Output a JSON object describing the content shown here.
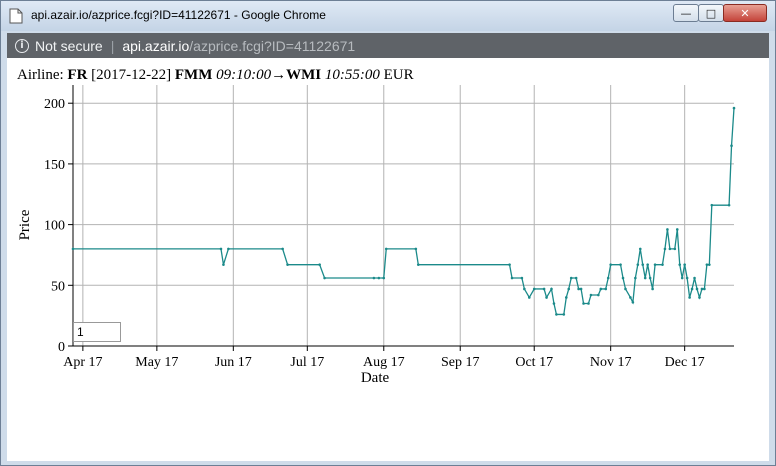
{
  "window": {
    "title": "api.azair.io/azprice.fcgi?ID=41122671 - Google Chrome",
    "min_label": "—",
    "max_label": "□",
    "close_label": "✕"
  },
  "addressbar": {
    "info_icon": "info-icon",
    "security_label": "Not secure",
    "separator": "|",
    "url_host": "api.azair.io",
    "url_path": "/azprice.fcgi?ID=41122671"
  },
  "heading": {
    "airline_prefix": "Airline: ",
    "airline": "FR",
    "date": " [2017-12-22] ",
    "origin": "FMM",
    "dep_time": " 09:10:00",
    "arrow": "→",
    "destination": "WMI",
    "arr_time": " 10:55:00",
    "currency": " EUR"
  },
  "range_input": {
    "value": "1"
  },
  "colors": {
    "line": "#1b8a8a",
    "grid": "#b3b3b3",
    "axis": "#000000"
  },
  "chart_data": {
    "type": "line",
    "title": "",
    "xlabel": "Date",
    "ylabel": "Price",
    "ylim": [
      0,
      215
    ],
    "xlim": [
      "2017-03-28",
      "2017-12-21"
    ],
    "x_ticks": [
      {
        "date": "2017-04-01",
        "label": "Apr 17"
      },
      {
        "date": "2017-05-01",
        "label": "May 17"
      },
      {
        "date": "2017-06-01",
        "label": "Jun 17"
      },
      {
        "date": "2017-07-01",
        "label": "Jul 17"
      },
      {
        "date": "2017-08-01",
        "label": "Aug 17"
      },
      {
        "date": "2017-09-01",
        "label": "Sep 17"
      },
      {
        "date": "2017-10-01",
        "label": "Oct 17"
      },
      {
        "date": "2017-11-01",
        "label": "Nov 17"
      },
      {
        "date": "2017-12-01",
        "label": "Dec 17"
      }
    ],
    "y_ticks": [
      0,
      50,
      100,
      150,
      200
    ],
    "grid": true,
    "series": [
      {
        "points": [
          [
            "2017-03-28",
            80
          ],
          [
            "2017-05-27",
            80
          ],
          [
            "2017-05-28",
            67
          ],
          [
            "2017-05-30",
            80
          ],
          [
            "2017-06-21",
            80
          ],
          [
            "2017-06-23",
            67
          ],
          [
            "2017-07-06",
            67
          ],
          [
            "2017-07-08",
            56
          ],
          [
            "2017-07-28",
            56
          ],
          [
            "2017-07-30",
            56
          ],
          [
            "2017-08-01",
            56
          ],
          [
            "2017-08-02",
            80
          ],
          [
            "2017-08-14",
            80
          ],
          [
            "2017-08-15",
            67
          ],
          [
            "2017-09-21",
            67
          ],
          [
            "2017-09-22",
            56
          ],
          [
            "2017-09-26",
            56
          ],
          [
            "2017-09-27",
            47
          ],
          [
            "2017-09-29",
            40
          ],
          [
            "2017-10-01",
            47
          ],
          [
            "2017-10-05",
            47
          ],
          [
            "2017-10-06",
            40
          ],
          [
            "2017-10-08",
            47
          ],
          [
            "2017-10-09",
            35
          ],
          [
            "2017-10-10",
            26
          ],
          [
            "2017-10-13",
            26
          ],
          [
            "2017-10-14",
            40
          ],
          [
            "2017-10-15",
            47
          ],
          [
            "2017-10-16",
            56
          ],
          [
            "2017-10-18",
            56
          ],
          [
            "2017-10-19",
            47
          ],
          [
            "2017-10-20",
            47
          ],
          [
            "2017-10-21",
            35
          ],
          [
            "2017-10-23",
            35
          ],
          [
            "2017-10-24",
            42
          ],
          [
            "2017-10-27",
            42
          ],
          [
            "2017-10-28",
            47
          ],
          [
            "2017-10-30",
            47
          ],
          [
            "2017-10-31",
            56
          ],
          [
            "2017-11-01",
            67
          ],
          [
            "2017-11-05",
            67
          ],
          [
            "2017-11-06",
            56
          ],
          [
            "2017-11-07",
            47
          ],
          [
            "2017-11-09",
            40
          ],
          [
            "2017-11-10",
            36
          ],
          [
            "2017-11-11",
            56
          ],
          [
            "2017-11-12",
            67
          ],
          [
            "2017-11-13",
            80
          ],
          [
            "2017-11-14",
            67
          ],
          [
            "2017-11-15",
            56
          ],
          [
            "2017-11-16",
            67
          ],
          [
            "2017-11-17",
            56
          ],
          [
            "2017-11-18",
            47
          ],
          [
            "2017-11-19",
            67
          ],
          [
            "2017-11-22",
            67
          ],
          [
            "2017-11-23",
            80
          ],
          [
            "2017-11-24",
            96
          ],
          [
            "2017-11-25",
            80
          ],
          [
            "2017-11-27",
            80
          ],
          [
            "2017-11-28",
            96
          ],
          [
            "2017-11-29",
            67
          ],
          [
            "2017-11-30",
            56
          ],
          [
            "2017-12-01",
            67
          ],
          [
            "2017-12-02",
            56
          ],
          [
            "2017-12-03",
            40
          ],
          [
            "2017-12-04",
            47
          ],
          [
            "2017-12-05",
            56
          ],
          [
            "2017-12-06",
            47
          ],
          [
            "2017-12-07",
            40
          ],
          [
            "2017-12-08",
            47
          ],
          [
            "2017-12-09",
            47
          ],
          [
            "2017-12-10",
            67
          ],
          [
            "2017-12-11",
            67
          ],
          [
            "2017-12-12",
            116
          ],
          [
            "2017-12-19",
            116
          ],
          [
            "2017-12-20",
            165
          ],
          [
            "2017-12-21",
            196
          ]
        ]
      }
    ]
  }
}
